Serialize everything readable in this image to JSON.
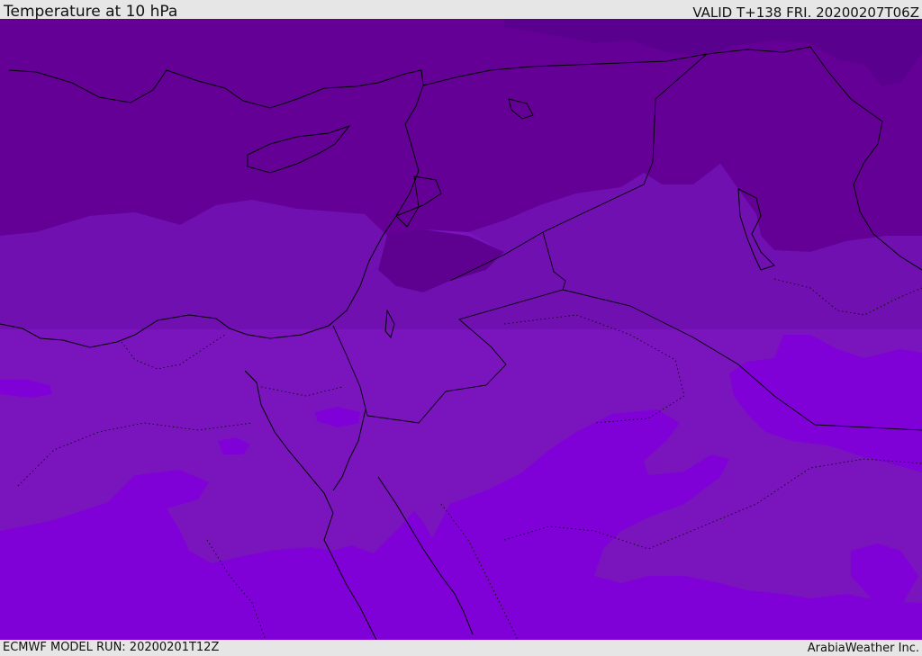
{
  "header": {
    "title": "Temperature at 10 hPa",
    "valid": "VALID T+138 FRI. 20200207T06Z"
  },
  "footer": {
    "model_run": "ECMWF MODEL RUN: 20200201T12Z",
    "brand": "ArabiaWeather Inc."
  },
  "map": {
    "colors": {
      "band_darkest": "#5a008e",
      "band_dark": "#640096",
      "band_mid": "#7110b0",
      "band_mid2": "#7a14bd",
      "band_light": "#8000d8",
      "coast": "#000000"
    }
  }
}
